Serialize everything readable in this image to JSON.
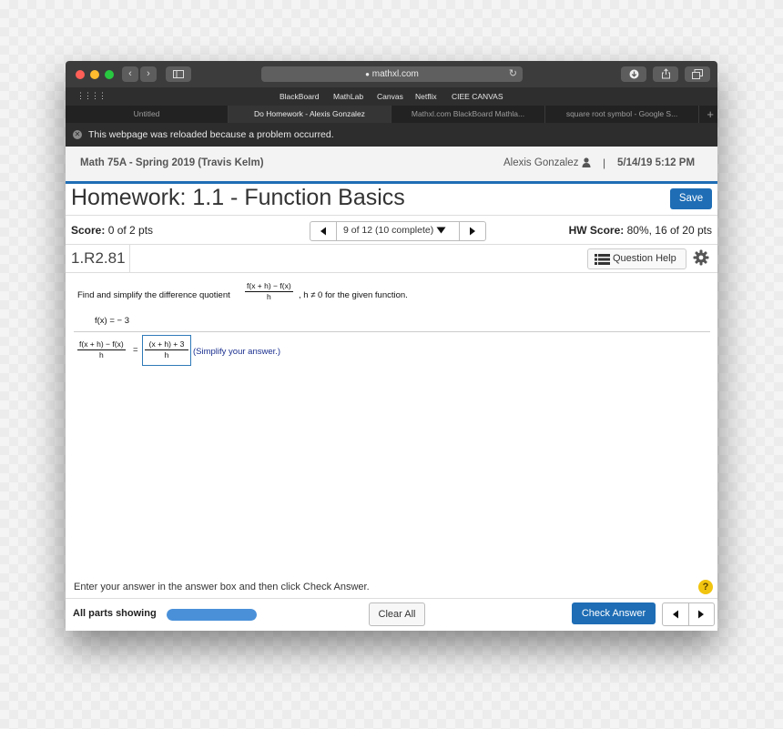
{
  "browser": {
    "url": "mathxl.com",
    "bookmarks": [
      "BlackBoard",
      "MathLab",
      "Canvas",
      "Netflix",
      "CIEE CANVAS"
    ],
    "tabs": [
      {
        "label": "Untitled",
        "active": false
      },
      {
        "label": "Do Homework - Alexis Gonzalez",
        "active": true
      },
      {
        "label": "Mathxl.com BlackBoard Mathla...",
        "active": false
      },
      {
        "label": "square root symbol - Google S...",
        "active": false
      }
    ],
    "new_tab": "+",
    "notice": "This webpage was reloaded because a problem occurred."
  },
  "course": {
    "name": "Math 75A - Spring 2019 (Travis Kelm)",
    "user": "Alexis Gonzalez",
    "separator": "|",
    "datetime": "5/14/19 5:12 PM"
  },
  "homework": {
    "title": "Homework: 1.1 - Function Basics",
    "save_label": "Save",
    "score_label": "Score:",
    "score_value": " 0 of 2 pts",
    "nav_label": "9 of 12 (10 complete)",
    "hw_score_label": "HW Score:",
    "hw_score_value": " 80%, 16 of 20 pts",
    "question_id": "1.R2.81",
    "question_help_label": "Question Help"
  },
  "question": {
    "prompt_before": "Find and simplify the difference quotient",
    "dq_num": "f(x + h) − f(x)",
    "dq_den": "h",
    "prompt_after": ", h ≠ 0 for the given function.",
    "function": "f(x) = − 3",
    "lhs_num": "f(x + h) − f(x)",
    "lhs_den": "h",
    "equals": "=",
    "answer_num": "(x + h) + 3",
    "answer_den": "h",
    "hint": "(Simplify your answer.)"
  },
  "footer": {
    "instruction": "Enter your answer in the answer box and then click Check Answer.",
    "help": "?",
    "all_parts": "All parts showing",
    "progress": 1.0,
    "clear_all": "Clear All",
    "check_answer": "Check Answer"
  },
  "colors": {
    "accent": "#1e6db5",
    "progress": "#4a90d9",
    "hint_text": "#1a2f8f",
    "help_badge": "#f1c40f"
  }
}
